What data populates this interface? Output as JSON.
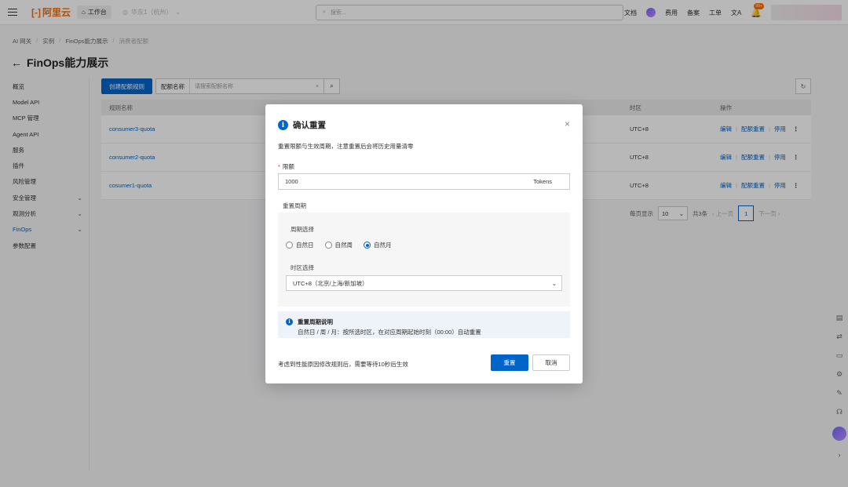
{
  "header": {
    "logo_text": "阿里云",
    "workbench_label": "工作台",
    "region_label": "华东1（杭州）",
    "search_placeholder": "搜索...",
    "links": [
      "文档",
      "费用",
      "备案",
      "工单"
    ],
    "notification_count": "99+"
  },
  "breadcrumb": [
    "AI 网关",
    "实例",
    "FinOps能力展示",
    "消费者配额"
  ],
  "page_title": "FinOps能力展示",
  "sidebar": {
    "items": [
      {
        "label": "概览",
        "expandable": false,
        "active": false
      },
      {
        "label": "Model API",
        "expandable": false,
        "active": false
      },
      {
        "label": "MCP 管理",
        "expandable": false,
        "active": false
      },
      {
        "label": "Agent API",
        "expandable": false,
        "active": false
      },
      {
        "label": "服务",
        "expandable": false,
        "active": false
      },
      {
        "label": "插件",
        "expandable": false,
        "active": false
      },
      {
        "label": "风险管理",
        "expandable": false,
        "active": false
      },
      {
        "label": "安全管理",
        "expandable": true,
        "active": false
      },
      {
        "label": "观测分析",
        "expandable": true,
        "active": false
      },
      {
        "label": "FinOps",
        "expandable": true,
        "active": true
      },
      {
        "label": "参数配置",
        "expandable": false,
        "active": false
      }
    ]
  },
  "toolbar": {
    "create_label": "创建配额规则",
    "filter_label": "配额名称",
    "filter_placeholder": "请搜索配额名称"
  },
  "table": {
    "columns": [
      "规则名称",
      "时区",
      "操作"
    ],
    "rows": [
      {
        "name": "consumer3-quota",
        "timezone": "UTC+8"
      },
      {
        "name": "consumer2-quota",
        "timezone": "UTC+8"
      },
      {
        "name": "cosumer1-quota",
        "timezone": "UTC+8"
      }
    ],
    "actions": [
      "编辑",
      "配额重置",
      "停用"
    ]
  },
  "pager": {
    "per_page_label": "每页显示",
    "page_size": "10",
    "total": "共3条",
    "prev": "上一页",
    "current": "1",
    "next": "下一页"
  },
  "modal": {
    "title": "确认重置",
    "description": "重置限额与生效周期，注意重置后会将历史用量清零",
    "quota_label": "限额",
    "quota_value": "1000",
    "quota_unit": "Tokens",
    "cycle_section": "重置周期",
    "cycle_label": "周期选择",
    "cycle_options": [
      "自然日",
      "自然周",
      "自然月"
    ],
    "cycle_selected": "自然月",
    "tz_label": "时区选择",
    "tz_value": "UTC+8（北京/上海/新加坡）",
    "notice_title": "重置周期说明",
    "notice_body": "自然日 / 周 / 月：按所选时区，在对应周期起始时刻（00:00）自动重置",
    "footer_note": "考虑到性能原因修改规则后，需要等待10秒后生效",
    "ok_label": "重置",
    "cancel_label": "取消"
  }
}
